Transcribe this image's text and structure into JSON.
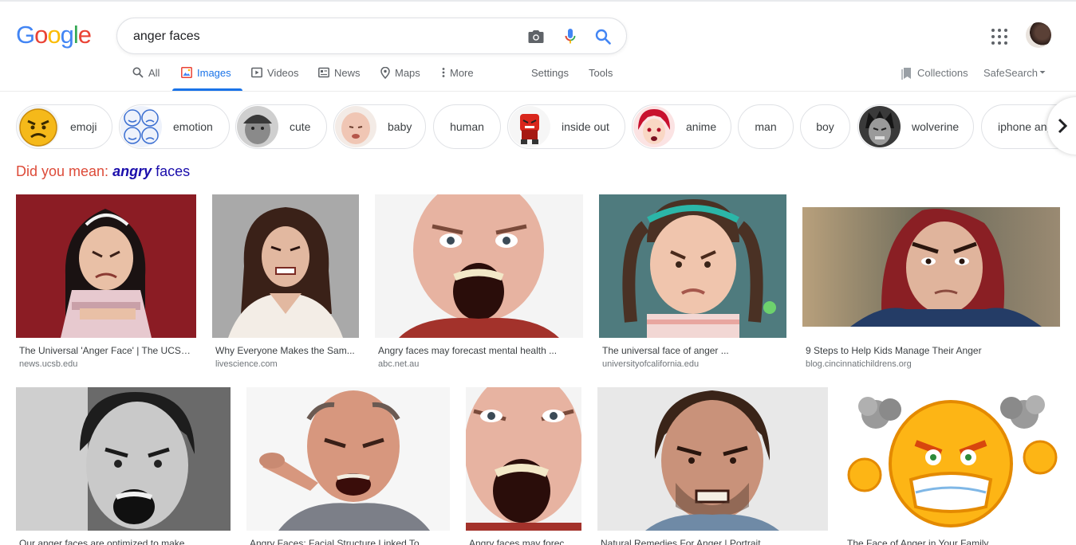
{
  "search": {
    "query": "anger faces"
  },
  "nav": {
    "tabs": [
      "All",
      "Images",
      "Videos",
      "News",
      "Maps",
      "More"
    ],
    "active_tab": "Images",
    "settings_label": "Settings",
    "tools_label": "Tools",
    "collections_label": "Collections",
    "safesearch_label": "SafeSearch"
  },
  "chips": [
    "emoji",
    "emotion",
    "cute",
    "baby",
    "human",
    "inside out",
    "anime",
    "man",
    "boy",
    "wolverine",
    "iphone ang"
  ],
  "did_you_mean": {
    "prefix": "Did you mean:",
    "bold_word": "angry",
    "rest": "faces"
  },
  "results_row1": [
    {
      "title": "The Universal 'Anger Face' | The UCSB...",
      "domain": "news.ucsb.edu"
    },
    {
      "title": "Why Everyone Makes the Sam...",
      "domain": "livescience.com"
    },
    {
      "title": "Angry faces may forecast mental health ...",
      "domain": "abc.net.au"
    },
    {
      "title": "The universal face of anger ...",
      "domain": "universityofcalifornia.edu"
    },
    {
      "title": "9 Steps to Help Kids Manage Their Anger",
      "domain": "blog.cincinnatichildrens.org"
    }
  ],
  "results_row2": [
    {
      "title": "Our anger faces are optimized to make ..."
    },
    {
      "title": "Angry Faces: Facial Structure Linked To ..."
    },
    {
      "title": "Angry faces may forec..."
    },
    {
      "title": "Natural Remedies For Anger | Portrait ..."
    },
    {
      "title": "The Face of Anger in Your Family"
    }
  ],
  "colors": {
    "google_blue": "#4285f4",
    "google_red": "#ea4335",
    "google_yellow": "#fbbc05",
    "google_green": "#34a853",
    "active_tab": "#1a73e8",
    "did_you_mean_red": "#dd4b39",
    "link_purple": "#1a0dab"
  }
}
